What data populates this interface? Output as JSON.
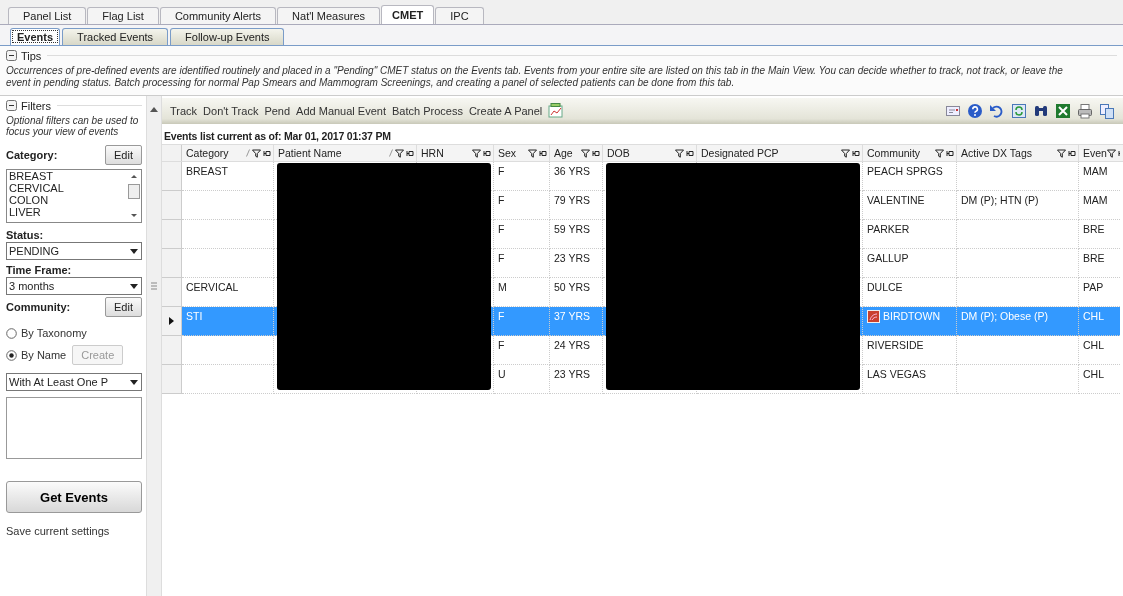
{
  "top_tabs": [
    {
      "label": "Panel List",
      "selected": false
    },
    {
      "label": "Flag List",
      "selected": false
    },
    {
      "label": "Community Alerts",
      "selected": false
    },
    {
      "label": "Nat'l Measures",
      "selected": false
    },
    {
      "label": "CMET",
      "selected": true
    },
    {
      "label": "IPC",
      "selected": false
    }
  ],
  "sub_tabs": [
    {
      "label": "Events",
      "selected": true
    },
    {
      "label": "Tracked Events",
      "selected": false
    },
    {
      "label": "Follow-up Events",
      "selected": false
    }
  ],
  "tips": {
    "title": "Tips",
    "expanded": true,
    "text": "Occurrences of pre-defined events are identified routinely and placed in a \"Pending\" CMET status on the Events tab.  Events from your entire site are listed on this tab in the Main View.  You can decide whether to track, not track, or leave the event in pending status. Batch processing for normal Pap Smears and Mammogram Screenings, and creating a panel of selected patients can be done from this tab."
  },
  "filters": {
    "title": "Filters",
    "expanded": true,
    "hint": "Optional filters can be used to focus your view of events",
    "category_label": "Category:",
    "category_edit": "Edit",
    "categories": [
      "BREAST",
      "CERVICAL",
      "COLON",
      "LIVER"
    ],
    "status_label": "Status:",
    "status_value": "PENDING",
    "timeframe_label": "Time Frame:",
    "timeframe_value": "3 months",
    "community_label": "Community:",
    "community_edit": "Edit",
    "radios": [
      {
        "label": "By Taxonomy",
        "selected": false
      },
      {
        "label": "By Name",
        "selected": true
      }
    ],
    "create_button": {
      "label": "Create",
      "disabled": true
    },
    "match_value": "With At Least One P",
    "get_events": "Get Events",
    "save_settings": "Save current settings"
  },
  "toolbar": {
    "actions": [
      "Track",
      "Don't Track",
      "Pend",
      "Add Manual Event",
      "Batch Process",
      "Create A Panel"
    ]
  },
  "list_caption": "Events list current as of: Mar 01, 2017 01:37 PM",
  "table": {
    "columns": [
      {
        "label": "Category",
        "sorted": true,
        "redacted": false
      },
      {
        "label": "Patient Name",
        "sorted": true,
        "redacted": true
      },
      {
        "label": "HRN",
        "sorted": false,
        "redacted": true
      },
      {
        "label": "Sex",
        "sorted": false,
        "redacted": false
      },
      {
        "label": "Age",
        "sorted": false,
        "redacted": false
      },
      {
        "label": "DOB",
        "sorted": false,
        "redacted": true
      },
      {
        "label": "Designated PCP",
        "sorted": false,
        "redacted": true
      },
      {
        "label": "Community",
        "sorted": false,
        "redacted": false
      },
      {
        "label": "Active DX Tags",
        "sorted": false,
        "redacted": false
      },
      {
        "label": "Even",
        "sorted": false,
        "redacted": false
      }
    ],
    "rows": [
      {
        "selected": false,
        "flag": false,
        "cells": [
          "BREAST",
          null,
          null,
          "F",
          "36 YRS",
          null,
          null,
          "PEACH SPRGS",
          null,
          "MAM"
        ]
      },
      {
        "selected": false,
        "flag": false,
        "cells": [
          null,
          null,
          null,
          "F",
          "79 YRS",
          null,
          null,
          "VALENTINE",
          "DM (P); HTN (P)",
          "MAM"
        ]
      },
      {
        "selected": false,
        "flag": false,
        "cells": [
          null,
          null,
          null,
          "F",
          "59 YRS",
          null,
          null,
          "PARKER",
          null,
          "BRE"
        ]
      },
      {
        "selected": false,
        "flag": false,
        "cells": [
          null,
          null,
          null,
          "F",
          "23 YRS",
          null,
          null,
          "GALLUP",
          null,
          "BRE"
        ]
      },
      {
        "selected": false,
        "flag": false,
        "cells": [
          "CERVICAL",
          null,
          null,
          "M",
          "50 YRS",
          null,
          null,
          "DULCE",
          null,
          "PAP"
        ]
      },
      {
        "selected": true,
        "flag": true,
        "cells": [
          "STI",
          null,
          null,
          "F",
          "37 YRS",
          null,
          null,
          "BIRDTOWN",
          "DM (P); Obese (P)",
          "CHL"
        ]
      },
      {
        "selected": false,
        "flag": false,
        "cells": [
          null,
          null,
          null,
          "F",
          "24 YRS",
          null,
          null,
          "RIVERSIDE",
          null,
          "CHL"
        ]
      },
      {
        "selected": false,
        "flag": false,
        "cells": [
          null,
          null,
          null,
          "U",
          "23 YRS",
          null,
          null,
          "LAS VEGAS",
          null,
          "CHL"
        ]
      }
    ]
  }
}
